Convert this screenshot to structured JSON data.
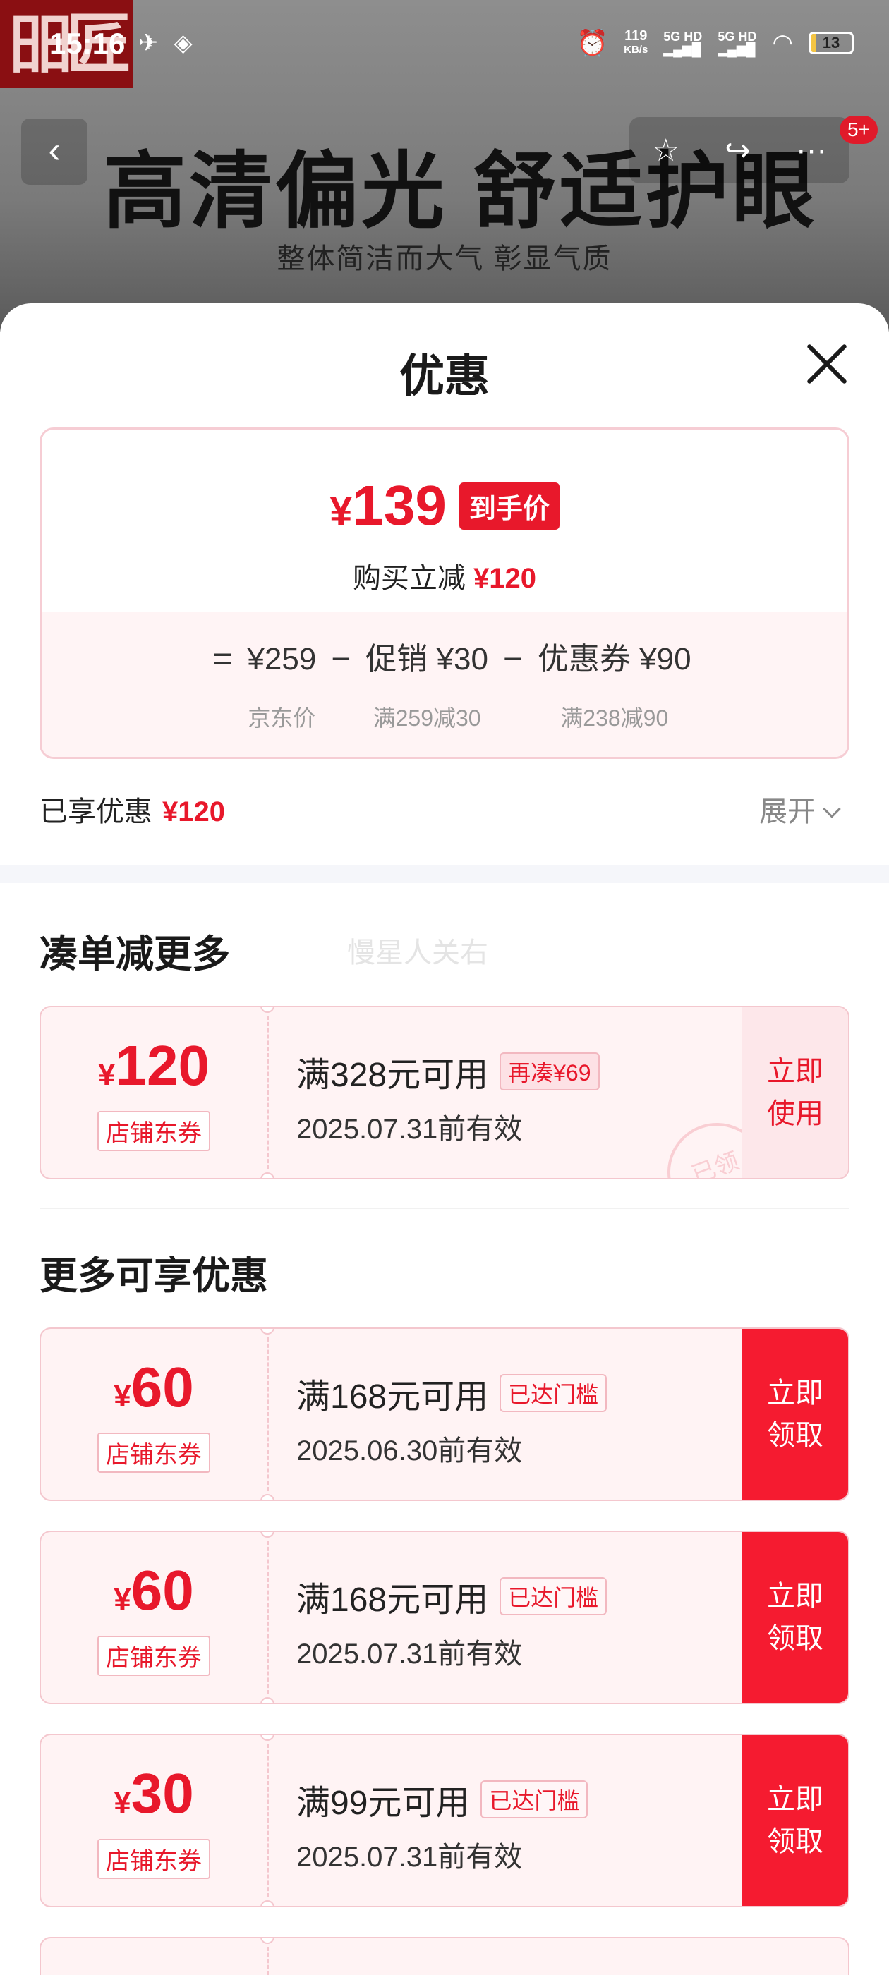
{
  "status_bar": {
    "time": "15:16",
    "net_speed_value": "119",
    "net_speed_unit": "KB/s",
    "signal_1": "5G HD",
    "signal_2": "5G HD",
    "battery": "13"
  },
  "background": {
    "logo_text": "昍匠",
    "banner_title": "高清偏光 舒适护眼",
    "banner_subtitle": "整体简洁而大气 彰显气质",
    "message_badge": "5+"
  },
  "sheet": {
    "title": "优惠",
    "final_price_symbol": "¥",
    "final_price": "139",
    "final_price_tag": "到手价",
    "reduce_label": "购买立减",
    "reduce_amount": "¥120",
    "breakdown": {
      "equals": "=",
      "op_minus": "−",
      "items": [
        {
          "main": "¥259",
          "sub": "京东价"
        },
        {
          "main": "促销 ¥30",
          "sub": "满259减30"
        },
        {
          "main": "优惠券 ¥90",
          "sub": "满238减90"
        }
      ]
    },
    "enjoyed_label": "已享优惠",
    "enjoyed_amount": "¥120",
    "expand_label": "展开",
    "section_more": "凑单减更多",
    "watermark": "慢星人关右",
    "section_available": "更多可享优惠"
  },
  "coupons_more": [
    {
      "symbol": "¥",
      "amount": "120",
      "type": "店铺东券",
      "condition": "满328元可用",
      "badge": "再凑¥69",
      "expiry": "2025.07.31前有效",
      "action": "立即\n使用",
      "stamp": "已领"
    }
  ],
  "coupons_available": [
    {
      "symbol": "¥",
      "amount": "60",
      "type": "店铺东券",
      "condition": "满168元可用",
      "badge": "已达门槛",
      "expiry": "2025.06.30前有效",
      "action": "立即\n领取"
    },
    {
      "symbol": "¥",
      "amount": "60",
      "type": "店铺东券",
      "condition": "满168元可用",
      "badge": "已达门槛",
      "expiry": "2025.07.31前有效",
      "action": "立即\n领取"
    },
    {
      "symbol": "¥",
      "amount": "30",
      "type": "店铺东券",
      "condition": "满99元可用",
      "badge": "已达门槛",
      "expiry": "2025.07.31前有效",
      "action": "立即\n领取"
    }
  ],
  "colors": {
    "accent": "#e8182b",
    "button_red": "#f51b30",
    "coupon_bg": "#fff3f4"
  }
}
